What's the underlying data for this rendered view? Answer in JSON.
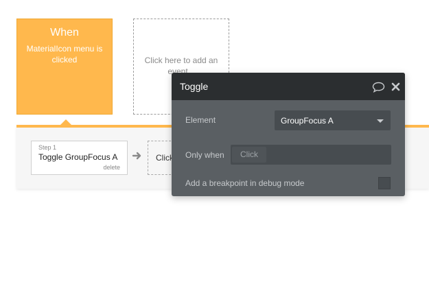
{
  "event": {
    "title": "When",
    "description": "MaterialIcon menu is clicked"
  },
  "add_event": {
    "label": "Click here to add an event..."
  },
  "workflow": {
    "step": {
      "number_label": "Step 1",
      "title": "Toggle GroupFocus A",
      "delete_label": "delete"
    },
    "add_action_label": "Click here to add an action..."
  },
  "panel": {
    "title": "Toggle",
    "element_label": "Element",
    "element_value": "GroupFocus A",
    "only_when_label": "Only when",
    "only_when_chip": "Click",
    "breakpoint_label": "Add a breakpoint in debug mode",
    "breakpoint_checked": false
  },
  "colors": {
    "event_accent": "#ffb84d",
    "panel_header": "#2b2e30",
    "panel_body": "#5a5f63"
  },
  "icons": [
    "comment-icon",
    "close-icon",
    "arrow-right-icon",
    "chevron-down-icon"
  ]
}
